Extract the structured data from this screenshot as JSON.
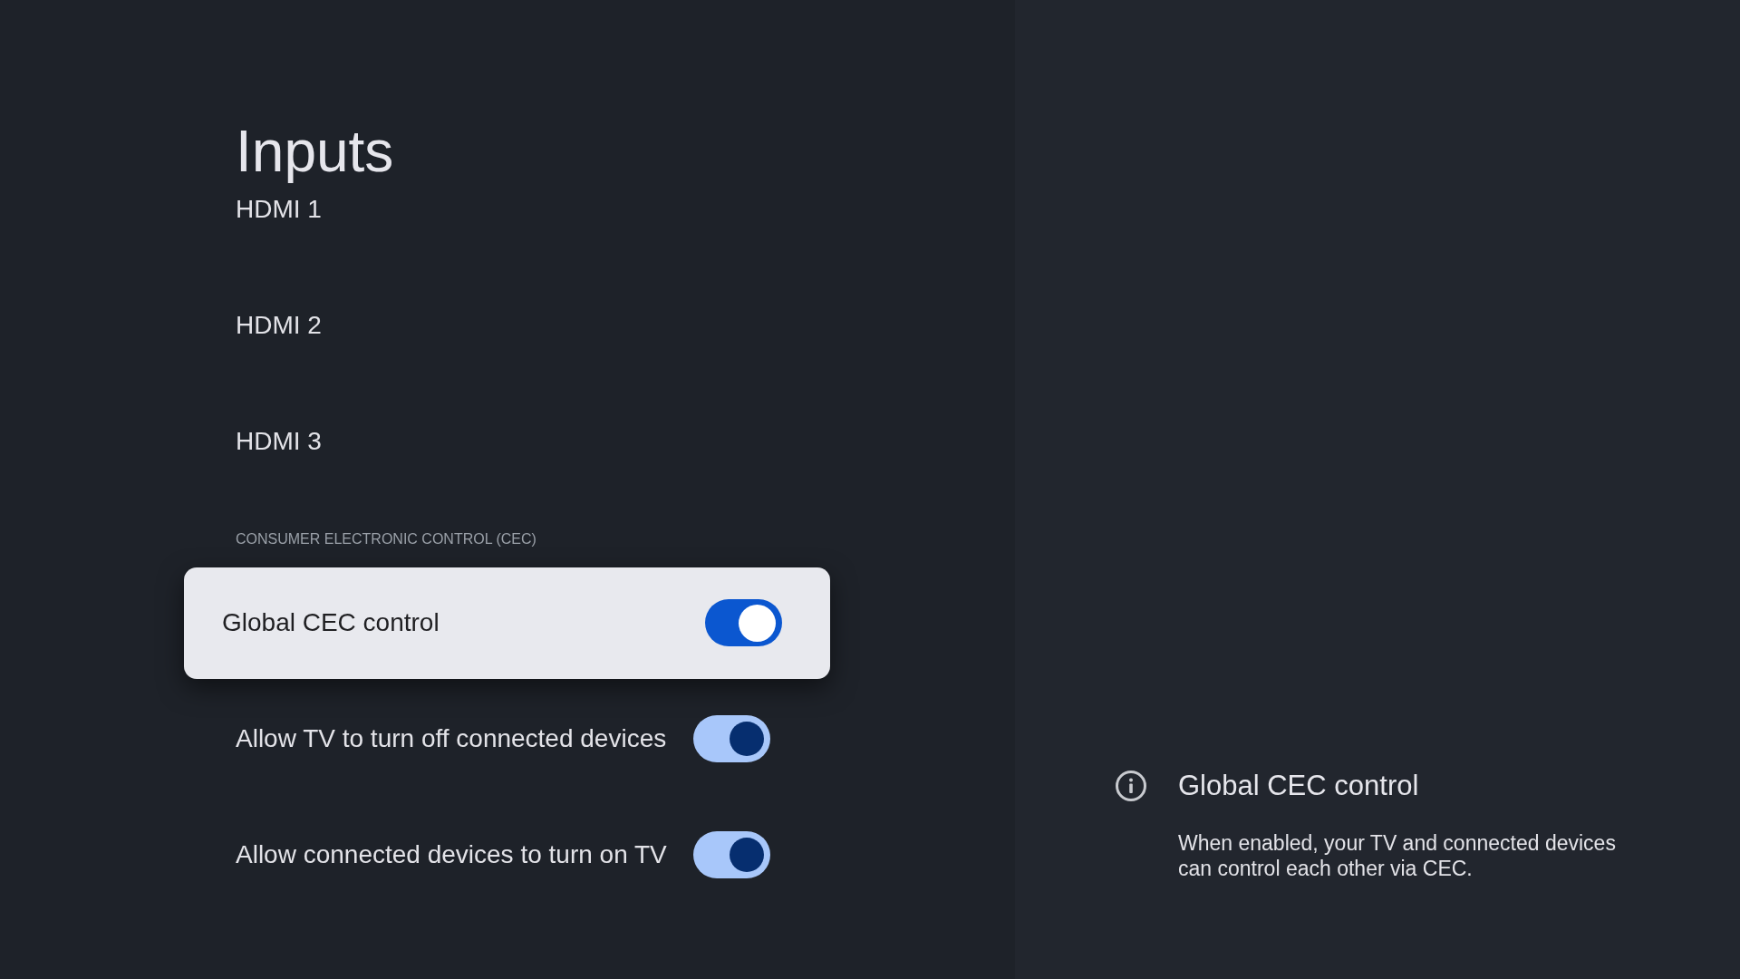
{
  "title": "Inputs",
  "inputs": [
    {
      "label": "HDMI 1",
      "selected": false
    },
    {
      "label": "HDMI 2",
      "selected": false
    },
    {
      "label": "HDMI 3",
      "selected": false
    }
  ],
  "cec": {
    "heading": "CONSUMER ELECTRONIC CONTROL (CEC)",
    "settings": [
      {
        "label": "Global CEC control",
        "on": true,
        "selected": true
      },
      {
        "label": "Allow TV to turn off connected devices",
        "on": true,
        "selected": false
      },
      {
        "label": "Allow connected devices to turn on TV",
        "on": true,
        "selected": false
      }
    ]
  },
  "info_panel": {
    "title": "Global CEC control",
    "description": "When enabled, your TV and connected devices can control each other via CEC."
  }
}
